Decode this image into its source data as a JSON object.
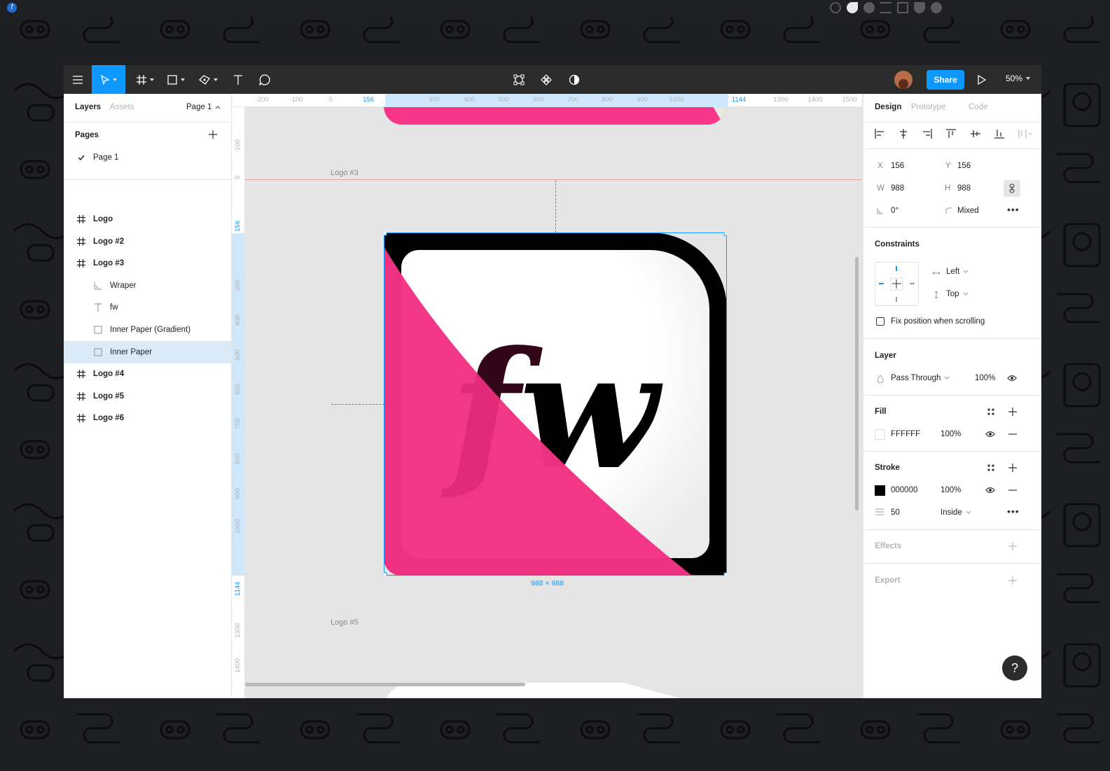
{
  "window": {
    "toolbar": {
      "share_label": "Share",
      "zoom_label": "50%"
    },
    "left_panel": {
      "tabs": [
        "Layers",
        "Assets"
      ],
      "page_selector": "Page 1",
      "pages_title": "Pages",
      "pages": [
        "Page 1"
      ],
      "layers": [
        {
          "label": "Logo",
          "type": "frame",
          "bold": true
        },
        {
          "label": "Logo #2",
          "type": "frame",
          "bold": true
        },
        {
          "label": "Logo #3",
          "type": "frame",
          "bold": true
        },
        {
          "label": "Wraper",
          "type": "vector",
          "bold": false
        },
        {
          "label": "fw",
          "type": "text",
          "bold": false
        },
        {
          "label": "Inner Paper (Gradient)",
          "type": "rect",
          "bold": false
        },
        {
          "label": "Inner Paper",
          "type": "rect",
          "bold": false,
          "selected": true
        },
        {
          "label": "Logo #4",
          "type": "frame",
          "bold": true
        },
        {
          "label": "Logo #5",
          "type": "frame",
          "bold": true
        },
        {
          "label": "Logo #6",
          "type": "frame",
          "bold": true
        }
      ]
    },
    "rulers": {
      "top": [
        "-200",
        "-100",
        "0",
        "156",
        "300",
        "400",
        "500",
        "600",
        "700",
        "800",
        "900",
        "1000",
        "1144",
        "1300",
        "1400",
        "1500"
      ],
      "left": [
        "-100",
        "0",
        "156",
        "300",
        "400",
        "500",
        "600",
        "700",
        "800",
        "900",
        "1000",
        "1144",
        "1300",
        "1400"
      ]
    },
    "canvas": {
      "frame_label_top": "Logo #3",
      "frame_label_bottom": "Logo #5",
      "logo_text": "fw",
      "size_badge": "988 × 988",
      "colors": {
        "pink": "#f7368a",
        "black": "#000000",
        "white": "#FFFFFF",
        "selection": "#0d99ff"
      }
    },
    "right_panel": {
      "tabs": [
        "Design",
        "Prototype",
        "Code"
      ],
      "x_label": "X",
      "x_value": "156",
      "y_label": "Y",
      "y_value": "156",
      "w_label": "W",
      "w_value": "988",
      "h_label": "H",
      "h_value": "988",
      "rotation": "0°",
      "radius": "Mixed",
      "constraints_title": "Constraints",
      "constraint_h": "Left",
      "constraint_v": "Top",
      "fix_position": "Fix position when scrolling",
      "layer_title": "Layer",
      "blend_mode": "Pass Through",
      "layer_opacity": "100%",
      "fill_title": "Fill",
      "fill_hex": "FFFFFF",
      "fill_opacity": "100%",
      "stroke_title": "Stroke",
      "stroke_hex": "000000",
      "stroke_opacity": "100%",
      "stroke_weight": "50",
      "stroke_align": "Inside",
      "effects_title": "Effects",
      "export_title": "Export"
    },
    "help_label": "?"
  }
}
